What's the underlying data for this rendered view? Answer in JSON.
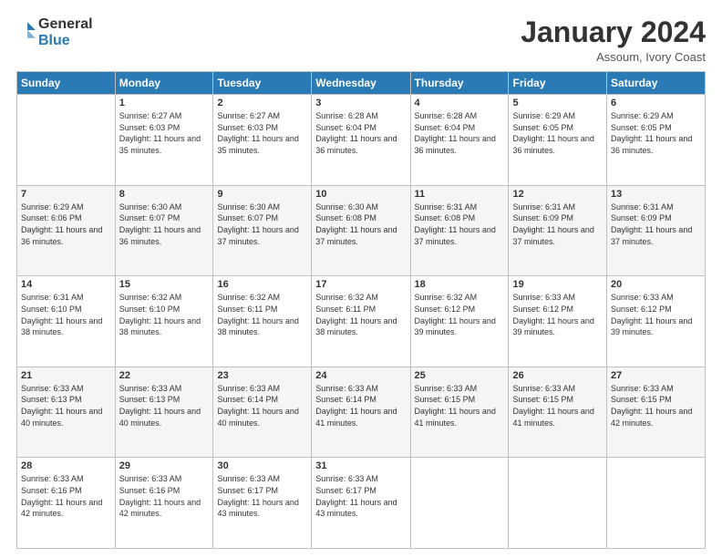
{
  "logo": {
    "line1": "General",
    "line2": "Blue"
  },
  "header": {
    "month": "January 2024",
    "location": "Assoum, Ivory Coast"
  },
  "weekdays": [
    "Sunday",
    "Monday",
    "Tuesday",
    "Wednesday",
    "Thursday",
    "Friday",
    "Saturday"
  ],
  "weeks": [
    [
      {
        "day": "",
        "sunrise": "",
        "sunset": "",
        "daylight": ""
      },
      {
        "day": "1",
        "sunrise": "Sunrise: 6:27 AM",
        "sunset": "Sunset: 6:03 PM",
        "daylight": "Daylight: 11 hours and 35 minutes."
      },
      {
        "day": "2",
        "sunrise": "Sunrise: 6:27 AM",
        "sunset": "Sunset: 6:03 PM",
        "daylight": "Daylight: 11 hours and 35 minutes."
      },
      {
        "day": "3",
        "sunrise": "Sunrise: 6:28 AM",
        "sunset": "Sunset: 6:04 PM",
        "daylight": "Daylight: 11 hours and 36 minutes."
      },
      {
        "day": "4",
        "sunrise": "Sunrise: 6:28 AM",
        "sunset": "Sunset: 6:04 PM",
        "daylight": "Daylight: 11 hours and 36 minutes."
      },
      {
        "day": "5",
        "sunrise": "Sunrise: 6:29 AM",
        "sunset": "Sunset: 6:05 PM",
        "daylight": "Daylight: 11 hours and 36 minutes."
      },
      {
        "day": "6",
        "sunrise": "Sunrise: 6:29 AM",
        "sunset": "Sunset: 6:05 PM",
        "daylight": "Daylight: 11 hours and 36 minutes."
      }
    ],
    [
      {
        "day": "7",
        "sunrise": "Sunrise: 6:29 AM",
        "sunset": "Sunset: 6:06 PM",
        "daylight": "Daylight: 11 hours and 36 minutes."
      },
      {
        "day": "8",
        "sunrise": "Sunrise: 6:30 AM",
        "sunset": "Sunset: 6:07 PM",
        "daylight": "Daylight: 11 hours and 36 minutes."
      },
      {
        "day": "9",
        "sunrise": "Sunrise: 6:30 AM",
        "sunset": "Sunset: 6:07 PM",
        "daylight": "Daylight: 11 hours and 37 minutes."
      },
      {
        "day": "10",
        "sunrise": "Sunrise: 6:30 AM",
        "sunset": "Sunset: 6:08 PM",
        "daylight": "Daylight: 11 hours and 37 minutes."
      },
      {
        "day": "11",
        "sunrise": "Sunrise: 6:31 AM",
        "sunset": "Sunset: 6:08 PM",
        "daylight": "Daylight: 11 hours and 37 minutes."
      },
      {
        "day": "12",
        "sunrise": "Sunrise: 6:31 AM",
        "sunset": "Sunset: 6:09 PM",
        "daylight": "Daylight: 11 hours and 37 minutes."
      },
      {
        "day": "13",
        "sunrise": "Sunrise: 6:31 AM",
        "sunset": "Sunset: 6:09 PM",
        "daylight": "Daylight: 11 hours and 37 minutes."
      }
    ],
    [
      {
        "day": "14",
        "sunrise": "Sunrise: 6:31 AM",
        "sunset": "Sunset: 6:10 PM",
        "daylight": "Daylight: 11 hours and 38 minutes."
      },
      {
        "day": "15",
        "sunrise": "Sunrise: 6:32 AM",
        "sunset": "Sunset: 6:10 PM",
        "daylight": "Daylight: 11 hours and 38 minutes."
      },
      {
        "day": "16",
        "sunrise": "Sunrise: 6:32 AM",
        "sunset": "Sunset: 6:11 PM",
        "daylight": "Daylight: 11 hours and 38 minutes."
      },
      {
        "day": "17",
        "sunrise": "Sunrise: 6:32 AM",
        "sunset": "Sunset: 6:11 PM",
        "daylight": "Daylight: 11 hours and 38 minutes."
      },
      {
        "day": "18",
        "sunrise": "Sunrise: 6:32 AM",
        "sunset": "Sunset: 6:12 PM",
        "daylight": "Daylight: 11 hours and 39 minutes."
      },
      {
        "day": "19",
        "sunrise": "Sunrise: 6:33 AM",
        "sunset": "Sunset: 6:12 PM",
        "daylight": "Daylight: 11 hours and 39 minutes."
      },
      {
        "day": "20",
        "sunrise": "Sunrise: 6:33 AM",
        "sunset": "Sunset: 6:12 PM",
        "daylight": "Daylight: 11 hours and 39 minutes."
      }
    ],
    [
      {
        "day": "21",
        "sunrise": "Sunrise: 6:33 AM",
        "sunset": "Sunset: 6:13 PM",
        "daylight": "Daylight: 11 hours and 40 minutes."
      },
      {
        "day": "22",
        "sunrise": "Sunrise: 6:33 AM",
        "sunset": "Sunset: 6:13 PM",
        "daylight": "Daylight: 11 hours and 40 minutes."
      },
      {
        "day": "23",
        "sunrise": "Sunrise: 6:33 AM",
        "sunset": "Sunset: 6:14 PM",
        "daylight": "Daylight: 11 hours and 40 minutes."
      },
      {
        "day": "24",
        "sunrise": "Sunrise: 6:33 AM",
        "sunset": "Sunset: 6:14 PM",
        "daylight": "Daylight: 11 hours and 41 minutes."
      },
      {
        "day": "25",
        "sunrise": "Sunrise: 6:33 AM",
        "sunset": "Sunset: 6:15 PM",
        "daylight": "Daylight: 11 hours and 41 minutes."
      },
      {
        "day": "26",
        "sunrise": "Sunrise: 6:33 AM",
        "sunset": "Sunset: 6:15 PM",
        "daylight": "Daylight: 11 hours and 41 minutes."
      },
      {
        "day": "27",
        "sunrise": "Sunrise: 6:33 AM",
        "sunset": "Sunset: 6:15 PM",
        "daylight": "Daylight: 11 hours and 42 minutes."
      }
    ],
    [
      {
        "day": "28",
        "sunrise": "Sunrise: 6:33 AM",
        "sunset": "Sunset: 6:16 PM",
        "daylight": "Daylight: 11 hours and 42 minutes."
      },
      {
        "day": "29",
        "sunrise": "Sunrise: 6:33 AM",
        "sunset": "Sunset: 6:16 PM",
        "daylight": "Daylight: 11 hours and 42 minutes."
      },
      {
        "day": "30",
        "sunrise": "Sunrise: 6:33 AM",
        "sunset": "Sunset: 6:17 PM",
        "daylight": "Daylight: 11 hours and 43 minutes."
      },
      {
        "day": "31",
        "sunrise": "Sunrise: 6:33 AM",
        "sunset": "Sunset: 6:17 PM",
        "daylight": "Daylight: 11 hours and 43 minutes."
      },
      {
        "day": "",
        "sunrise": "",
        "sunset": "",
        "daylight": ""
      },
      {
        "day": "",
        "sunrise": "",
        "sunset": "",
        "daylight": ""
      },
      {
        "day": "",
        "sunrise": "",
        "sunset": "",
        "daylight": ""
      }
    ]
  ]
}
